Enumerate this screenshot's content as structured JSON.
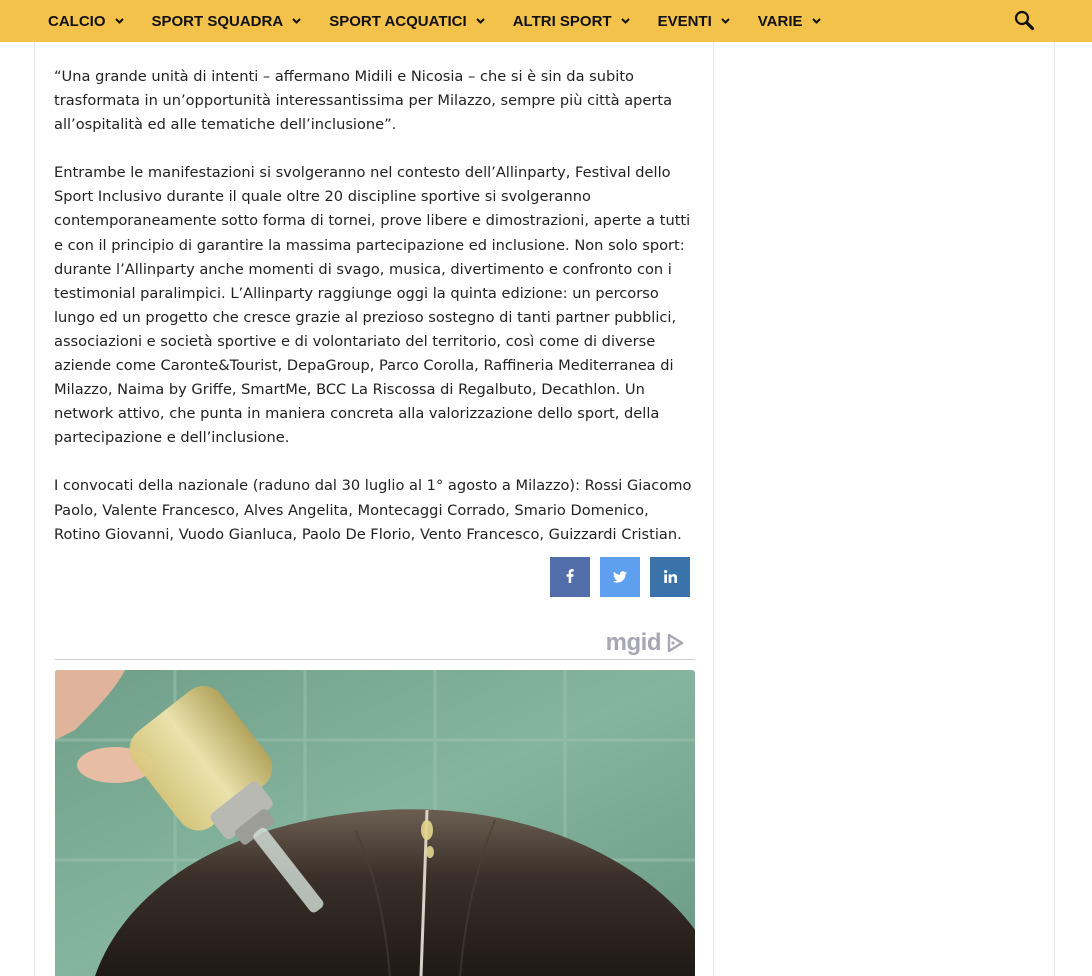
{
  "nav": {
    "items": [
      {
        "label": "CALCIO"
      },
      {
        "label": "SPORT SQUADRA"
      },
      {
        "label": "SPORT ACQUATICI"
      },
      {
        "label": "ALTRI SPORT"
      },
      {
        "label": "EVENTI"
      },
      {
        "label": "VARIE"
      }
    ],
    "search_icon": "search-icon",
    "background_color": "#f3c24b"
  },
  "article": {
    "paragraphs": [
      "“Una grande unità di intenti – affermano Midili e Nicosia – che si è sin da subito trasformata in un’opportunità interessantissima per Milazzo, sempre più città aperta all’ospitalità ed alle tematiche dell’inclusione”.",
      "Entrambe le manifestazioni si svolgeranno nel contesto dell’Allinparty, Festival dello Sport Inclusivo durante il quale oltre 20 discipline sportive si svolgeranno contemporaneamente sotto forma di tornei, prove libere e dimostrazioni, aperte a tutti e con il principio di garantire la massima partecipazione ed inclusione. Non solo sport: durante l’Allinparty anche momenti di svago, musica, divertimento e confronto con i testimonial paralimpici. L’Allinparty raggiunge oggi la quinta edizione: un percorso lungo ed un progetto che cresce grazie al prezioso sostegno di tanti partner pubblici, associazioni e società sportive e di volontariato del territorio, così come di diverse aziende come Caronte&Tourist, DepaGroup, Parco Corolla, Raffineria Mediterranea di Milazzo, Naima by Griffe, SmartMe, BCC La Riscossa di Regalbuto, Decathlon. Un network attivo, che punta in maniera concreta alla valorizzazione dello sport, della partecipazione e dell’inclusione.",
      "I convocati della nazionale (raduno dal 30 luglio al 1° agosto a Milazzo): Rossi Giacomo Paolo, Valente Francesco, Alves Angelita, Montecaggi Corrado, Smario Domenico, Rotino Giovanni, Vuodo Gianluca, Paolo De Florio, Vento Francesco, Guizzardi Cristian."
    ]
  },
  "share": {
    "buttons": [
      {
        "icon": "facebook-icon",
        "color": "#516eab"
      },
      {
        "icon": "twitter-icon",
        "color": "#5f9ff0"
      },
      {
        "icon": "linkedin-icon",
        "color": "#3a72aa"
      }
    ]
  },
  "ad": {
    "logo_text": "mgid",
    "logo_icon": "adchoices-icon",
    "image": "ad-image"
  }
}
